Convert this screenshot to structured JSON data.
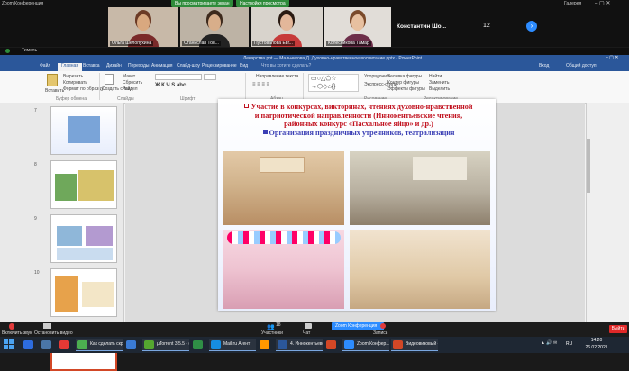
{
  "zoom": {
    "meeting_title": "Zoom Конференция",
    "share_badge": "Вы просматриваете экран ",
    "settings_badge": "Настройки просмотра",
    "participants": [
      {
        "name": "Ольга Шелопухина",
        "face": "#d9a87f",
        "hair": "#6b3a25",
        "body": "#7a2a2a",
        "bg": "#c8b9a8"
      },
      {
        "name": "Станислав Тол...",
        "face": "#d8ae8a",
        "hair": "#3d2a1d",
        "body": "#222",
        "bg": "#bdb3a5"
      },
      {
        "name": "Пустовалова Евг...",
        "face": "#e3b79a",
        "hair": "#2a1a12",
        "body": "#c73a3a",
        "bg": "#d8d3cc"
      },
      {
        "name": "Колесникова Тамар",
        "face": "#e7c0a0",
        "hair": "#7a4a2b",
        "body": "#6d2e4a",
        "bg": "#e1ddd8"
      }
    ],
    "top_right_name": "Константин  Шо...",
    "count": "12",
    "view": "Галерея",
    "bottom_left_label": "Тимель",
    "controls": {
      "unmute": "Включить звук",
      "video": "Остановить видео",
      "participants": "Участники",
      "participants_count": "18",
      "chat": "Чат",
      "record": "Запись",
      "leave": "Выйти"
    },
    "active_window": "Zoom Конференция"
  },
  "ppt": {
    "title": "Лекарства.ppt — Мальчикова Д. Духовно-нравственное воспитание.pptx - PowerPoint",
    "tabs": [
      "Файл",
      "Главная",
      "Вставка",
      "Дизайн",
      "Переходы",
      "Анимация",
      "Слайд-шоу",
      "Рецензирование",
      "Вид"
    ],
    "active_tab": "Главная",
    "search_hint": "Что вы хотите сделать?",
    "right_label": "Вход",
    "share_label": "Общий доступ",
    "ribbon_groups": [
      "Буфер обмена",
      "Слайды",
      "Шрифт",
      "Абзац",
      "Рисование",
      "Редактирование"
    ],
    "ribbon_items": {
      "paste": "Вставить",
      "cut": "Вырезать",
      "copy": "Копировать",
      "format": "Формат по образцу",
      "new_slide": "Создать слайд",
      "layout": "Макет",
      "reset": "Сбросить",
      "section": "Раздел",
      "align_text": "Направление текста",
      "arrange": "Упорядочить",
      "quick_styles": "Экспресс-стили",
      "fill": "Заливка фигуры",
      "outline": "Контур фигуры",
      "effects": "Эффекты фигуры",
      "find": "Найти",
      "replace": "Заменить",
      "select": "Выделить"
    },
    "slide_numbers": [
      "7",
      "8",
      "9",
      "10",
      "11"
    ],
    "slide": {
      "line1": "Участие в конкурсах, викторинах, чтениях духовно-нравственной",
      "line2": "и патриотической направленности (Иннокентьевские чтения,",
      "line3": "районных конкурс «Пасхальное яйцо» и др.)",
      "line4": "Организация праздничных утренников, театрализация"
    }
  },
  "taskbar": {
    "items": [
      {
        "label": "",
        "color": "#2d6cdf"
      },
      {
        "label": "",
        "color": "#4a76a8"
      },
      {
        "label": "",
        "color": "#e53935"
      },
      {
        "label": "Как сделать скрин...",
        "color": "#4caf50"
      },
      {
        "label": "",
        "color": "#3a7bd5"
      },
      {
        "label": "µTorrent 3.5.5 - (...",
        "color": "#55a630"
      },
      {
        "label": "",
        "color": "#2f8f46"
      },
      {
        "label": "Mail.ru Агент",
        "color": "#168de2"
      },
      {
        "label": "",
        "color": "#ff9800"
      },
      {
        "label": "4. Иннокентьевск...",
        "color": "#2b579a"
      },
      {
        "label": "",
        "color": "#d24726"
      },
      {
        "label": "Zoom Конфер...",
        "color": "#2d8cff"
      },
      {
        "label": "Видеовизовый - P...",
        "color": "#d24726"
      }
    ],
    "lang": "RU",
    "time": "14:20",
    "date": "26.02.2021"
  }
}
